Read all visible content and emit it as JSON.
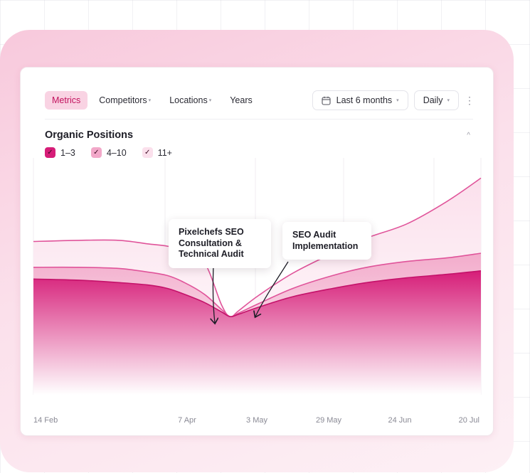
{
  "toolbar": {
    "tabs": [
      {
        "label": "Metrics",
        "active": true
      },
      {
        "label": "Competitors",
        "has_dropdown": true
      },
      {
        "label": "Locations",
        "has_dropdown": true
      },
      {
        "label": "Years",
        "has_dropdown": false
      }
    ],
    "range_label": "Last 6 months",
    "granularity_label": "Daily"
  },
  "icons": {
    "calendar": "calendar-icon",
    "more": "more-vertical-icon",
    "collapse": "chevron-up-icon",
    "check": "check-icon"
  },
  "colors": {
    "accent": "#d61d78",
    "accent_light": "#f2a8c9",
    "accent_lighter": "#fbe0ec",
    "active_tab_bg": "#f9d3e3"
  },
  "section": {
    "title": "Organic Positions"
  },
  "legend": [
    {
      "label": "1–3",
      "checked": true
    },
    {
      "label": "4–10",
      "checked": true
    },
    {
      "label": "11+",
      "checked": true
    }
  ],
  "annotations": [
    {
      "lines": [
        "Pixelchefs SEO",
        "Consultation &",
        "Technical Audit"
      ]
    },
    {
      "lines": [
        "SEO Audit",
        "Implementation"
      ]
    }
  ],
  "chart_data": {
    "type": "area",
    "stacked": true,
    "title": "Organic Positions",
    "x_tick_labels": [
      "14 Feb",
      "7 Apr",
      "3 May",
      "29 May",
      "24 Jun",
      "20 Jul"
    ],
    "x": [
      "2024-02-14",
      "2024-03-01",
      "2024-03-15",
      "2024-03-25",
      "2024-04-01",
      "2024-04-07",
      "2024-04-14",
      "2024-04-20",
      "2024-04-23",
      "2024-04-26",
      "2024-05-03",
      "2024-05-15",
      "2024-05-29",
      "2024-06-10",
      "2024-06-24",
      "2024-07-08",
      "2024-07-20"
    ],
    "series": [
      {
        "name": "1–3",
        "values": [
          58,
          57,
          55,
          53,
          50,
          45,
          38,
          30,
          26,
          28,
          34,
          43,
          50,
          55,
          59,
          62,
          65
        ]
      },
      {
        "name": "4–10",
        "values": [
          68,
          68,
          67,
          64,
          61,
          55,
          45,
          32,
          26,
          29,
          37,
          50,
          61,
          68,
          73,
          76,
          80
        ]
      },
      {
        "name": "11+",
        "values": [
          90,
          91,
          91,
          88,
          86,
          82,
          72,
          36,
          26,
          31,
          44,
          63,
          80,
          93,
          105,
          124,
          144
        ]
      }
    ],
    "grid": true,
    "legend_position": "top-left"
  }
}
